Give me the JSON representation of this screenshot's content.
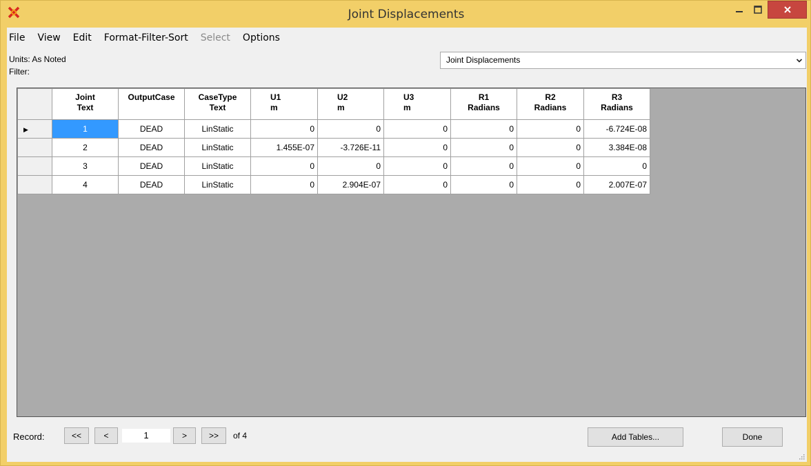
{
  "window": {
    "title": "Joint Displacements",
    "accent_color": "#f2cf68",
    "close_color": "#c7463f"
  },
  "menu": [
    "File",
    "View",
    "Edit",
    "Format-Filter-Sort",
    "Select",
    "Options"
  ],
  "menu_disabled": [
    "Select"
  ],
  "units": "Units: As Noted",
  "filter": "Filter:",
  "table_selector": {
    "value": "Joint Displacements"
  },
  "grid": {
    "columns": [
      {
        "line1": "Joint",
        "line2": "Text"
      },
      {
        "line1": "OutputCase",
        "line2": ""
      },
      {
        "line1": "CaseType",
        "line2": "Text"
      },
      {
        "line1": "U1",
        "line2": "m"
      },
      {
        "line1": "U2",
        "line2": "m"
      },
      {
        "line1": "U3",
        "line2": "m"
      },
      {
        "line1": "R1",
        "line2": "Radians"
      },
      {
        "line1": "R2",
        "line2": "Radians"
      },
      {
        "line1": "R3",
        "line2": "Radians"
      }
    ],
    "rows": [
      [
        "1",
        "DEAD",
        "LinStatic",
        "0",
        "0",
        "0",
        "0",
        "0",
        "-6.724E-08"
      ],
      [
        "2",
        "DEAD",
        "LinStatic",
        "1.455E-07",
        "-3.726E-11",
        "0",
        "0",
        "0",
        "3.384E-08"
      ],
      [
        "3",
        "DEAD",
        "LinStatic",
        "0",
        "0",
        "0",
        "0",
        "0",
        "0"
      ],
      [
        "4",
        "DEAD",
        "LinStatic",
        "0",
        "2.904E-07",
        "0",
        "0",
        "0",
        "2.007E-07"
      ]
    ],
    "selected_row": 0
  },
  "record": {
    "label": "Record:",
    "first": "<<",
    "prev": "<",
    "current": "1",
    "next": ">",
    "last": ">>",
    "of": "of 4"
  },
  "buttons": {
    "add_tables": "Add Tables...",
    "done": "Done"
  }
}
